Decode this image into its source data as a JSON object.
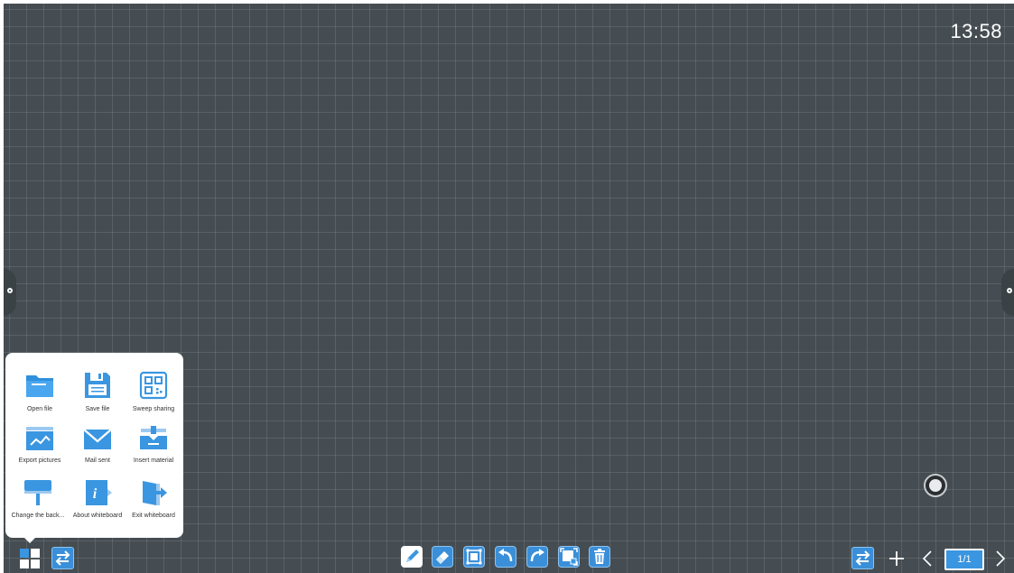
{
  "clock": "13:58",
  "menu": {
    "items": [
      {
        "label": "Open file",
        "icon": "folder-icon"
      },
      {
        "label": "Save file",
        "icon": "floppy-icon"
      },
      {
        "label": "Sweep sharing",
        "icon": "qr-code-icon"
      },
      {
        "label": "Export pictures",
        "icon": "picture-icon"
      },
      {
        "label": "Mail sent",
        "icon": "mail-icon"
      },
      {
        "label": "Insert material",
        "icon": "insert-tray-icon"
      },
      {
        "label": "Change the back...",
        "icon": "paint-roller-icon"
      },
      {
        "label": "About whiteboard",
        "icon": "info-icon"
      },
      {
        "label": "Exit whiteboard",
        "icon": "exit-door-icon"
      }
    ]
  },
  "toolbar": {
    "tools": [
      "pen-icon",
      "eraser-icon",
      "select-icon",
      "undo-icon",
      "redo-icon",
      "screenshot-icon",
      "trash-icon"
    ]
  },
  "page": {
    "indicator": "1/1"
  },
  "colors": {
    "board": "#454d52",
    "accent": "#3a96e0"
  }
}
